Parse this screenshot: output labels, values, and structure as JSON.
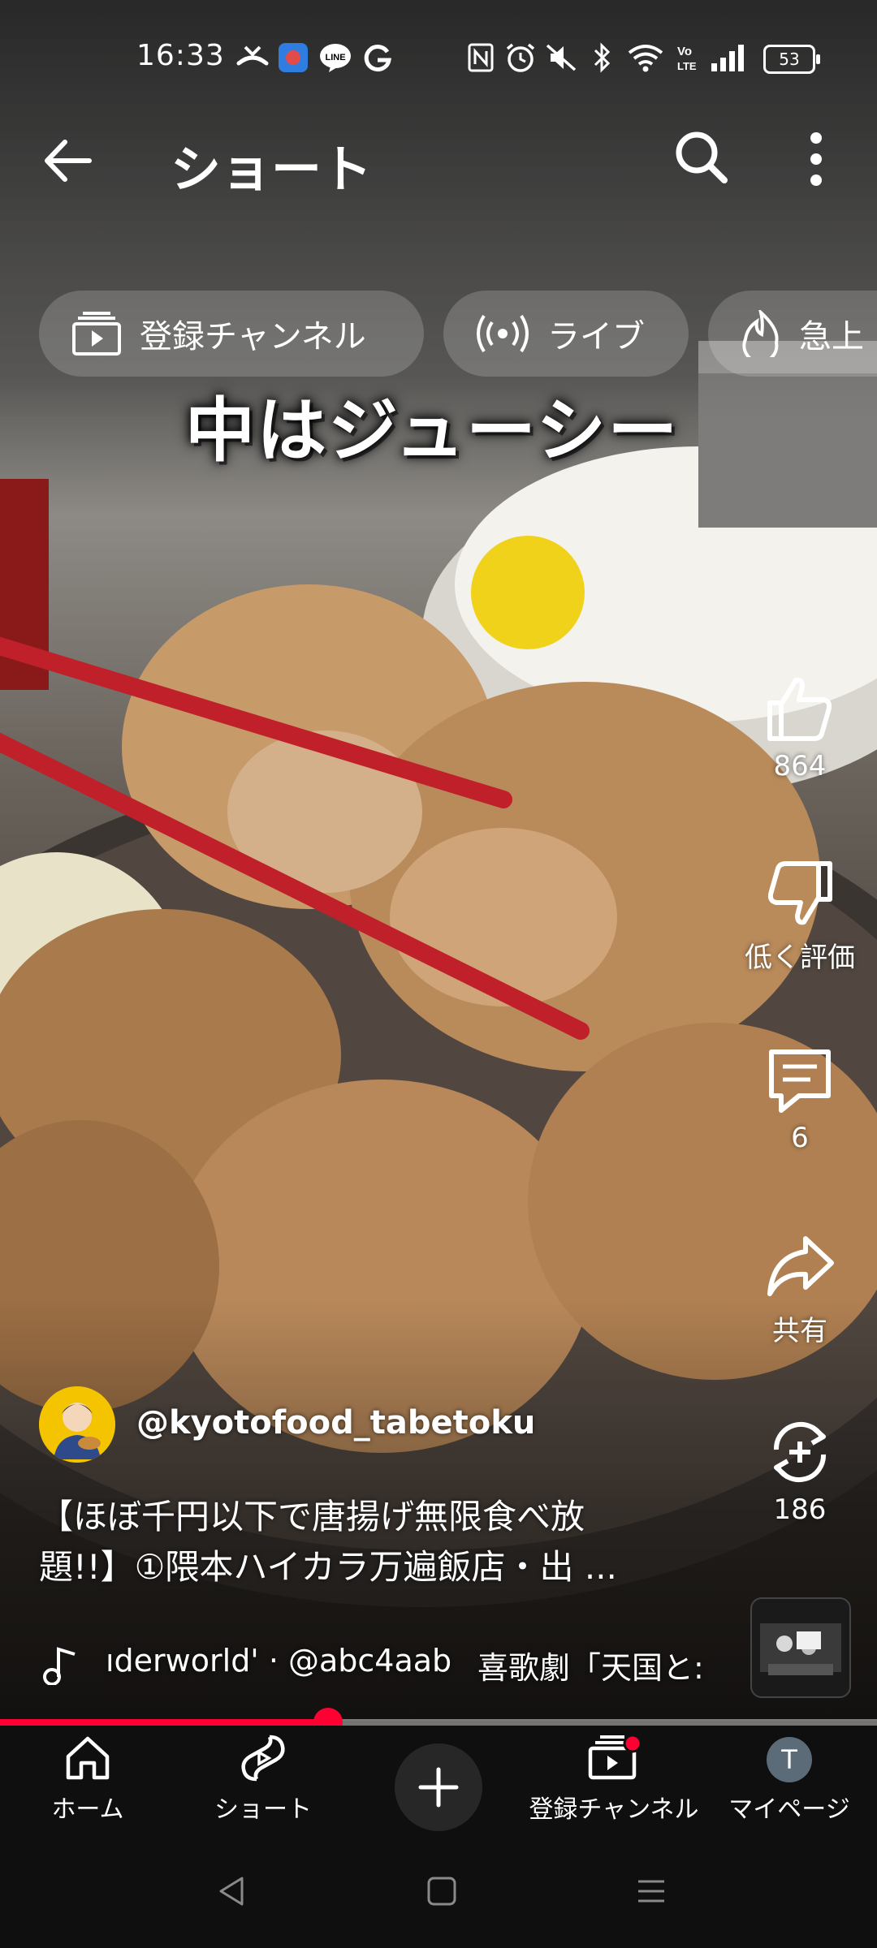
{
  "status_bar": {
    "time": "16:33",
    "battery": "53",
    "icons": [
      "missed-call-icon",
      "app-icon",
      "line-icon",
      "google-icon",
      "nfc-icon",
      "alarm-icon",
      "mute-icon",
      "bluetooth-icon",
      "wifi-icon",
      "volte-icon",
      "signal-icon",
      "battery-icon"
    ]
  },
  "header": {
    "title": "ショート"
  },
  "chips": [
    {
      "label": "登録チャンネル",
      "icon": "subscriptions-icon"
    },
    {
      "label": "ライブ",
      "icon": "live-icon"
    },
    {
      "label": "急上",
      "icon": "trending-icon"
    }
  ],
  "video": {
    "caption_overlay": "中はジューシー"
  },
  "actions": {
    "like_count": "864",
    "dislike_label": "低く評価",
    "comment_count": "6",
    "share_label": "共有",
    "remix_count": "186"
  },
  "channel": {
    "handle": "@kyotofood_tabetoku"
  },
  "description": {
    "line1": "【ほぼ千円以下で唐揚げ無限食べ放",
    "line2": "題!!】①隈本ハイカラ万遍飯店・出 ..."
  },
  "music": {
    "track": "ıderworld' · @abc4aab",
    "track2": "喜歌劇「天国と:"
  },
  "progress": {
    "fraction": 0.374
  },
  "bottom_nav": {
    "home": "ホーム",
    "shorts": "ショート",
    "subscriptions": "登録チャンネル",
    "mypage": "マイページ",
    "avatar_initial": "T"
  },
  "colors": {
    "accent": "#ff0033",
    "nav_bg": "#0f0f0f"
  }
}
